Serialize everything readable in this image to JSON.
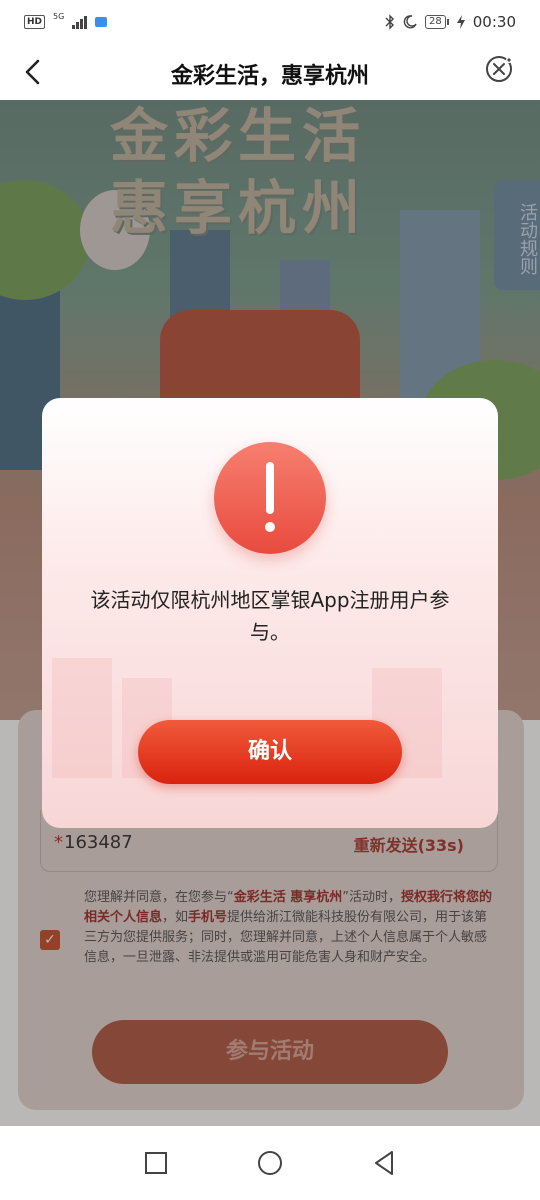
{
  "status_bar": {
    "hd": "HD",
    "network": "5G",
    "battery": "28",
    "time": "00:30"
  },
  "navbar": {
    "title": "金彩生活，惠享杭州"
  },
  "hero": {
    "title_line1": "金彩生活",
    "title_line2": "惠享杭州",
    "rules_tab": "活动规则"
  },
  "form": {
    "code_value": "163487",
    "resend_label": "重新发送(33s)",
    "agreement": {
      "p1": "您理解并同意，在您参与“",
      "activity": "金彩生活 惠享杭州",
      "p2": "”活动时，",
      "auth": "授权我行将您的相关个人信息",
      "p3": "，如",
      "phone": "手机号",
      "p4": "提供给浙江微能科技股份有限公司，用于该第三方为您提供服务；同时，您理解并同意，上述个人信息属于个人敏感信息，一旦泄露、非法提供或滥用可能危害人身和财产安全。"
    },
    "join_button": "参与活动"
  },
  "modal": {
    "message": "该活动仅限杭州地区掌银App注册用户参与。",
    "confirm_button": "确认"
  },
  "colors": {
    "accent": "#e8412a",
    "alert": "#ee5e50",
    "highlight": "#a0302a"
  }
}
